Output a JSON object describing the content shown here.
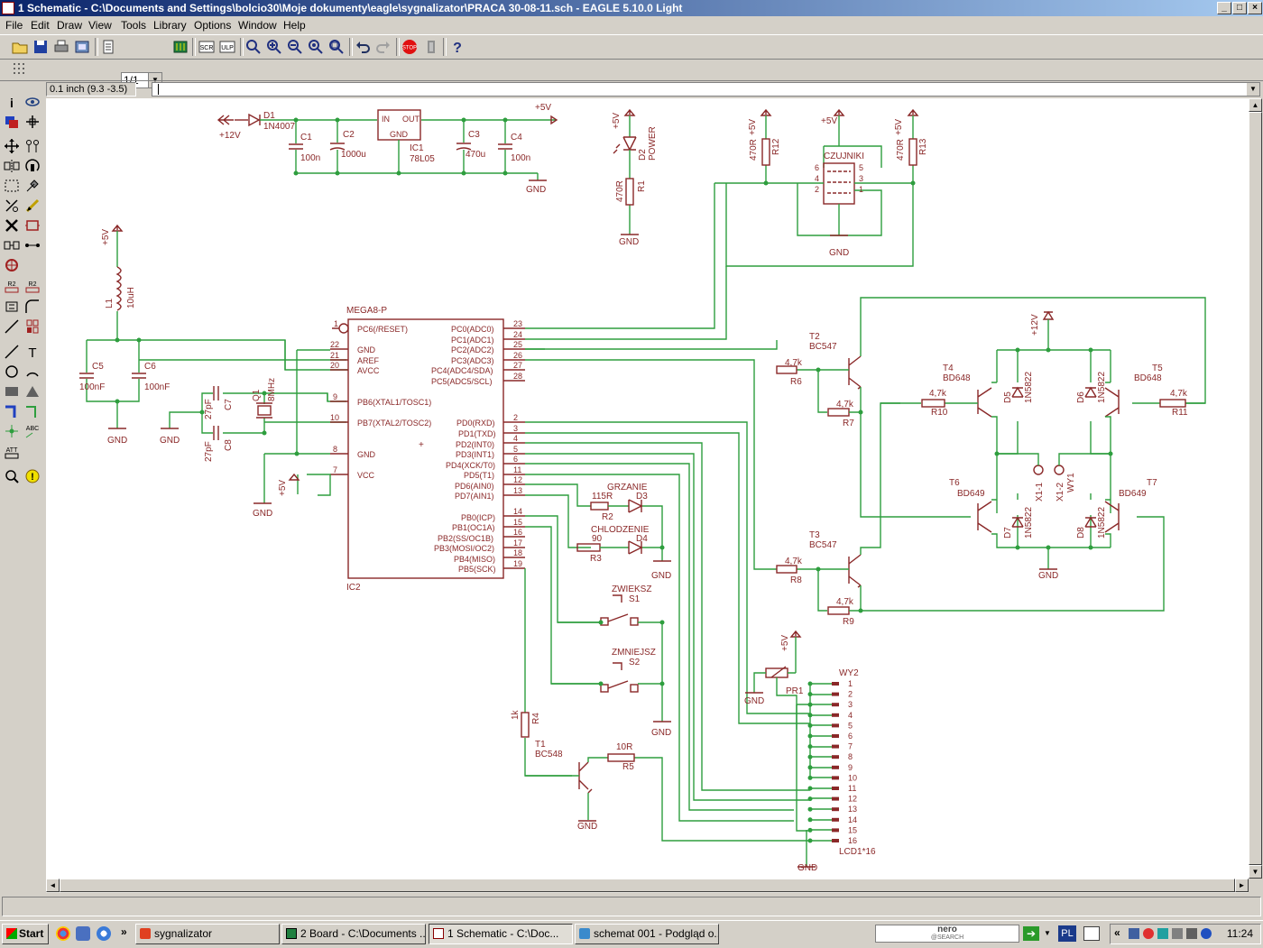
{
  "window": {
    "title": "1 Schematic - C:\\Documents and Settings\\bolcio30\\Moje dokumenty\\eagle\\sygnalizator\\PRACA 30-08-11.sch - EAGLE 5.10.0 Light",
    "minimize": "_",
    "maximize": "□",
    "close": "×"
  },
  "menu": [
    "File",
    "Edit",
    "Draw",
    "View",
    "Tools",
    "Library",
    "Options",
    "Window",
    "Help"
  ],
  "toolbar": {
    "sheet_select": "1/1",
    "icons": [
      "open-icon",
      "save-icon",
      "print-icon",
      "cam-icon",
      "script-icon",
      "board-icon",
      "zoom-fit-icon",
      "zoom-in-icon",
      "zoom-out-icon",
      "zoom-redraw-icon",
      "zoom-select-icon",
      "undo-icon",
      "redo-icon",
      "stop-icon",
      "go-icon",
      "help-icon"
    ],
    "stop_label": "STOP"
  },
  "command": {
    "coordinate": "0.1 inch (9.3 -3.5)",
    "input_value": ""
  },
  "left_toolbar": [
    "info-icon",
    "show-icon",
    "display-icon",
    "mark-icon",
    "move-icon",
    "copy-icon",
    "mirror-icon",
    "rotate-icon",
    "group-icon",
    "change-icon",
    "cut-icon",
    "paste-icon",
    "delete-icon",
    "add-icon",
    "pinswap-icon",
    "replace-icon",
    "gateswap-icon",
    "name-icon",
    "value-icon",
    "smash-icon",
    "miter-icon",
    "split-icon",
    "invoke-icon",
    "wire-icon",
    "text-icon",
    "circle-icon",
    "arc-icon",
    "rect-icon",
    "polygon-icon",
    "bus-icon",
    "net-icon",
    "junction-icon",
    "label-icon",
    "attribute-icon",
    "erc-icon",
    "errors-icon"
  ],
  "schematic": {
    "net_color": "#2e9e3e",
    "part_color": "#8a2828",
    "labels": {
      "d1": "D1",
      "d1v": "1N4007",
      "p12": "+12V",
      "c1": "C1",
      "c1v": "100n",
      "c2": "C2",
      "c2v": "1000u",
      "ic1in": "IN",
      "ic1out": "OUT",
      "ic1gnd": "GND",
      "ic1": "IC1",
      "ic1v": "78L05",
      "c3": "C3",
      "c3v": "470u",
      "c4": "C4",
      "c4v": "100n",
      "p5v": "+5V",
      "gnd": "GND",
      "d2": "D2",
      "d2v": "POWER",
      "r1": "R1",
      "r1v": "470R",
      "r12": "R12",
      "r12v": "470R",
      "r13": "R13",
      "r13v": "470R",
      "czujniki": "CZUJNIKI",
      "l1": "L1",
      "l1v": "10uH",
      "c5": "C5",
      "c5v": "100nF",
      "c6": "C6",
      "c6v": "100nF",
      "c7": "C7",
      "c7v": "27pF",
      "c8": "C8",
      "c8v": "27pF",
      "q1": "Q1",
      "q1v": "8MHz",
      "mega": "MEGA8-P",
      "ic2": "IC2",
      "pc6": "PC6(/RESET)",
      "gnd1": "GND",
      "aref": "AREF",
      "avcc": "AVCC",
      "pb6": "PB6(XTAL1/TOSC1)",
      "pb7": "PB7(XTAL2/TOSC2)",
      "gnd2": "GND",
      "vcc": "VCC",
      "pc0": "PC0(ADC0)",
      "pc1": "PC1(ADC1)",
      "pc2": "PC2(ADC2)",
      "pc3": "PC3(ADC3)",
      "pc4": "PC4(ADC4/SDA)",
      "pc5": "PC5(ADC5/SCL)",
      "pd0": "PD0(RXD)",
      "pd1": "PD1(TXD)",
      "pd2": "PD2(INT0)",
      "pd3": "PD3(INT1)",
      "pd4": "PD4(XCK/T0)",
      "pd5": "PD5(T1)",
      "pd6": "PD6(AIN0)",
      "pd7": "PD7(AIN1)",
      "pb0": "PB0(ICP)",
      "pb1": "PB1(OC1A)",
      "pb2": "PB2(SS/OC1B)",
      "pb3": "PB3(MOSI/OC2)",
      "pb4": "PB4(MISO)",
      "pb5": "PB5(SCK)",
      "pin1": "1",
      "pin22": "22",
      "pin21": "21",
      "pin20": "20",
      "pin9": "9",
      "pin10": "10",
      "pin8": "8",
      "pin7": "7",
      "pin23": "23",
      "pin24": "24",
      "pin25": "25",
      "pin26": "26",
      "pin27": "27",
      "pin28": "28",
      "pin2": "2",
      "pin3": "3",
      "pin4": "4",
      "pin5": "5",
      "pin6": "6",
      "pin11": "11",
      "pin12": "12",
      "pin13": "13",
      "pin14": "14",
      "pin15": "15",
      "pin16": "16",
      "pin17": "17",
      "pin18": "18",
      "pin19": "19",
      "grzanie": "GRZANIE",
      "r2": "R2",
      "r2v": "115R",
      "d3": "D3",
      "chlodzenie": "CHLODZENIE",
      "r3": "R3",
      "r3v": "90",
      "d4": "D4",
      "zwieksz": "ZWIEKSZ",
      "s1": "S1",
      "zmniejsz": "ZMNIEJSZ",
      "s2": "S2",
      "r4": "R4",
      "r4v": "1k",
      "t1": "T1",
      "t1v": "BC548",
      "r5": "R5",
      "r5v": "10R",
      "t2": "T2",
      "t2v": "BC547",
      "t3": "T3",
      "t3v": "BC547",
      "r6": "R6",
      "r7": "R7",
      "r8": "R8",
      "r9": "R9",
      "r10": "R10",
      "r11": "R11",
      "k47": "4,7k",
      "t4": "T4",
      "t4v": "BD648",
      "t5": "T5",
      "t5v": "BD648",
      "t6": "T6",
      "t6v": "BD649",
      "t7": "T7",
      "t7v": "BD649",
      "d5": "D5",
      "d6": "D6",
      "d7": "D7",
      "d8": "D8",
      "d1n5822": "1N5822",
      "x11": "X1-1",
      "x12": "X1-2",
      "wy1": "WY1",
      "p12b": "+12V",
      "pr1": "PR1",
      "wy2": "WY2",
      "lcd": "LCD1*16"
    },
    "lcd_pins": [
      "1",
      "2",
      "3",
      "4",
      "5",
      "6",
      "7",
      "8",
      "9",
      "10",
      "11",
      "12",
      "13",
      "14",
      "15",
      "16"
    ]
  },
  "taskbar": {
    "start": "Start",
    "tasks": [
      "sygnalizator",
      "2 Board - C:\\Documents ...",
      "1 Schematic - C:\\Doc...",
      "schemat 001 - Podgląd o..."
    ],
    "search_brand": "nero",
    "search_sub": "@SEARCH",
    "language": "PL",
    "clock": "11:24",
    "chevron": "»",
    "tray_chevron": "«"
  }
}
